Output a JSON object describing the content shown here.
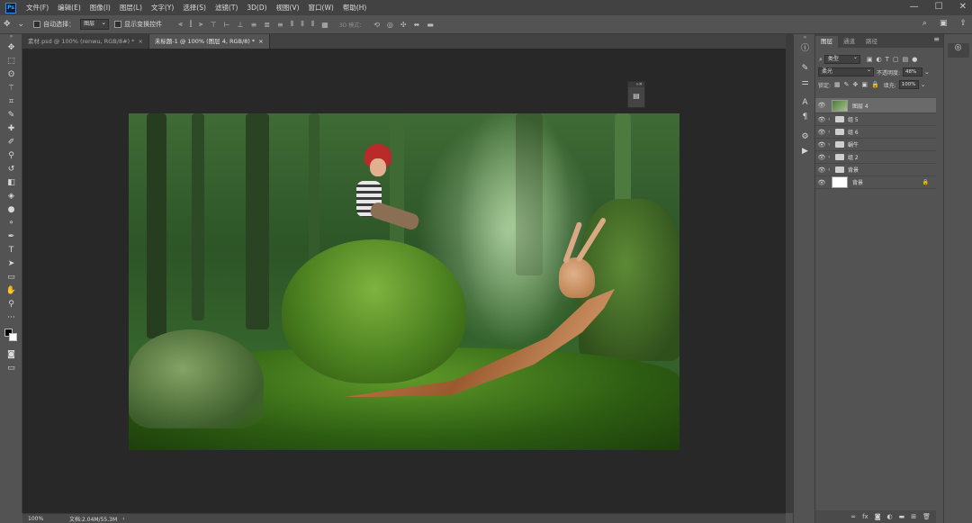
{
  "app": {
    "logo": "Ps"
  },
  "menubar": {
    "items": [
      "文件(F)",
      "编辑(E)",
      "图像(I)",
      "图层(L)",
      "文字(Y)",
      "选择(S)",
      "滤镜(T)",
      "3D(D)",
      "视图(V)",
      "窗口(W)",
      "帮助(H)"
    ]
  },
  "window_controls": {
    "minimize": "—",
    "maximize": "☐",
    "close": "✕"
  },
  "options": {
    "auto_select_label": "自动选择：",
    "auto_select_value": "图层",
    "show_transform_label": "显示变换控件",
    "mode3d_label": "3D 模式："
  },
  "tabs": [
    {
      "label": "素材.psd @ 100% (renwu, RGB/8#) *",
      "close": "×"
    },
    {
      "label": "未标题-1 @ 100% (图层 4, RGB/8) *",
      "close": "×"
    }
  ],
  "statusbar": {
    "zoom": "100%",
    "doc_info": "文档:2.04M/55.3M",
    "arrow": "›"
  },
  "layers_panel": {
    "tabs": [
      "图层",
      "通道",
      "路径"
    ],
    "filter_kind": "类型",
    "blend_mode": "柔光",
    "opacity_label": "不透明度:",
    "opacity_value": "48%",
    "lock_label": "锁定:",
    "fill_label": "填充:",
    "fill_value": "100%",
    "layers": [
      {
        "name": "图层 4",
        "type": "layer",
        "selected": true
      },
      {
        "name": "组 5",
        "type": "group"
      },
      {
        "name": "组 6",
        "type": "group"
      },
      {
        "name": "蜗牛",
        "type": "group"
      },
      {
        "name": "组 2",
        "type": "group"
      },
      {
        "name": "背景",
        "type": "group"
      },
      {
        "name": "背景",
        "type": "background",
        "locked": true
      }
    ]
  },
  "colors": {
    "ui_dark": "#535353",
    "menubar": "#424242",
    "canvas_bg": "#282828",
    "selected_layer": "#6a6a6a",
    "ps_blue": "#31a8ff"
  }
}
